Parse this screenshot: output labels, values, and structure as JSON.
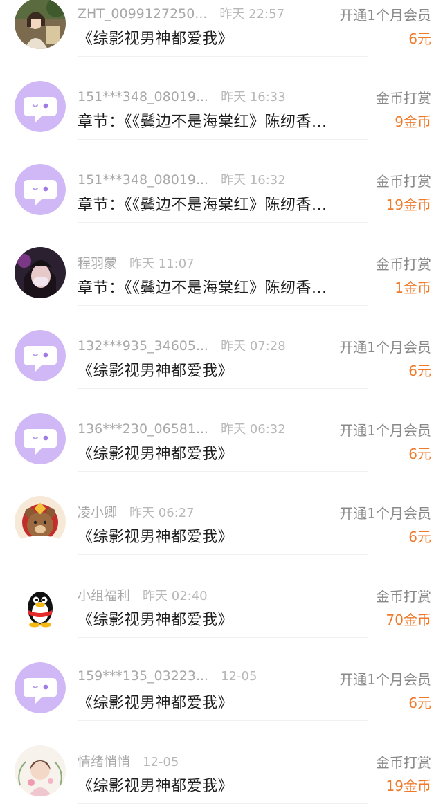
{
  "colors": {
    "amount": "#f07a2a",
    "default_avatar_bg": "#cfb8f5",
    "meta_text": "#a8a8a8",
    "title_text": "#1e1e1e"
  },
  "records": [
    {
      "user": "ZHT_0099127250...",
      "time": "昨天 22:57",
      "title": "《综影视男神都爱我》",
      "type": "开通1个月会员",
      "amount": "6元",
      "avatar": "photo-girl-painting-icon"
    },
    {
      "user": "151***348_08019...",
      "time": "昨天 16:33",
      "title": "章节：《《鬓边不是海棠红》陈纫香...",
      "type": "金币打赏",
      "amount": "9金币",
      "avatar": "default-chat-bubble-icon"
    },
    {
      "user": "151***348_08019...",
      "time": "昨天 16:32",
      "title": "章节：《《鬓边不是海棠红》陈纫香...",
      "type": "金币打赏",
      "amount": "19金币",
      "avatar": "default-chat-bubble-icon"
    },
    {
      "user": "程羽蒙",
      "time": "昨天 11:07",
      "title": "章节：《《鬓边不是海棠红》陈纫香...",
      "type": "金币打赏",
      "amount": "1金币",
      "avatar": "photo-masked-girl-icon"
    },
    {
      "user": "132***935_34605...",
      "time": "昨天 07:28",
      "title": "《综影视男神都爱我》",
      "type": "开通1个月会员",
      "amount": "6元",
      "avatar": "default-chat-bubble-icon"
    },
    {
      "user": "136***230_06581...",
      "time": "昨天 06:32",
      "title": "《综影视男神都爱我》",
      "type": "开通1个月会员",
      "amount": "6元",
      "avatar": "default-chat-bubble-icon"
    },
    {
      "user": "凌小卿",
      "time": "昨天 06:27",
      "title": "《综影视男神都爱我》",
      "type": "开通1个月会员",
      "amount": "6元",
      "avatar": "bear-fortune-icon"
    },
    {
      "user": "小组福利",
      "time": "昨天 02:40",
      "title": "《综影视男神都爱我》",
      "type": "金币打赏",
      "amount": "70金币",
      "avatar": "qq-penguin-icon"
    },
    {
      "user": "159***135_03223...",
      "time": "12-05",
      "title": "《综影视男神都爱我》",
      "type": "开通1个月会员",
      "amount": "6元",
      "avatar": "default-chat-bubble-icon"
    },
    {
      "user": "情绪悄悄",
      "time": "12-05",
      "title": "《综影视男神都爱我》",
      "type": "金币打赏",
      "amount": "19金币",
      "avatar": "cartoon-girl-flowers-icon"
    }
  ]
}
